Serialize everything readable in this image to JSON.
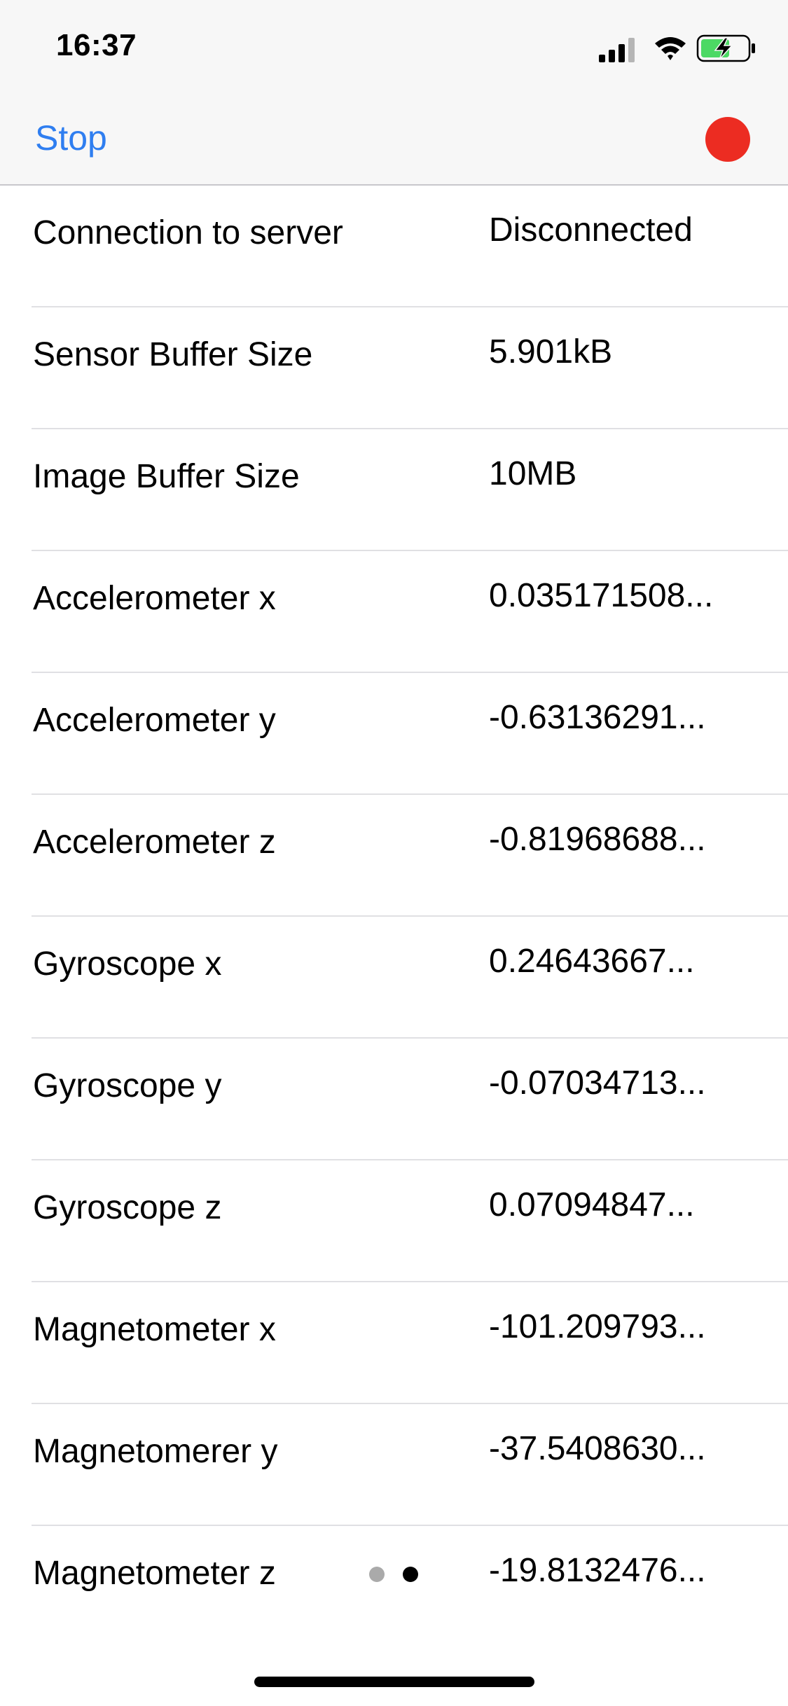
{
  "status_bar": {
    "time": "16:37",
    "icons": [
      "cellular-signal-icon",
      "wifi-icon",
      "battery-charging-icon"
    ]
  },
  "nav": {
    "left_button": "Stop",
    "right_indicator": "recording-indicator",
    "accent_color": "#2f7ef0",
    "record_color": "#ec2c22"
  },
  "rows": [
    {
      "label": "Connection to server",
      "value": "Disconnected"
    },
    {
      "label": "Sensor Buffer Size",
      "value": "5.901kB"
    },
    {
      "label": "Image Buffer Size",
      "value": "10MB"
    },
    {
      "label": "Accelerometer x",
      "value": "0.035171508..."
    },
    {
      "label": "Accelerometer y",
      "value": "-0.63136291..."
    },
    {
      "label": "Accelerometer z",
      "value": "-0.81968688..."
    },
    {
      "label": "Gyroscope x",
      "value": "0.24643667..."
    },
    {
      "label": "Gyroscope y",
      "value": "-0.07034713..."
    },
    {
      "label": "Gyroscope z",
      "value": "0.07094847..."
    },
    {
      "label": "Magnetometer x",
      "value": "-101.209793..."
    },
    {
      "label": "Magnetomerer y",
      "value": "-37.5408630..."
    },
    {
      "label": "Magnetometer z",
      "value": "-19.8132476..."
    }
  ],
  "page_control": {
    "pages": 2,
    "current": 2
  }
}
